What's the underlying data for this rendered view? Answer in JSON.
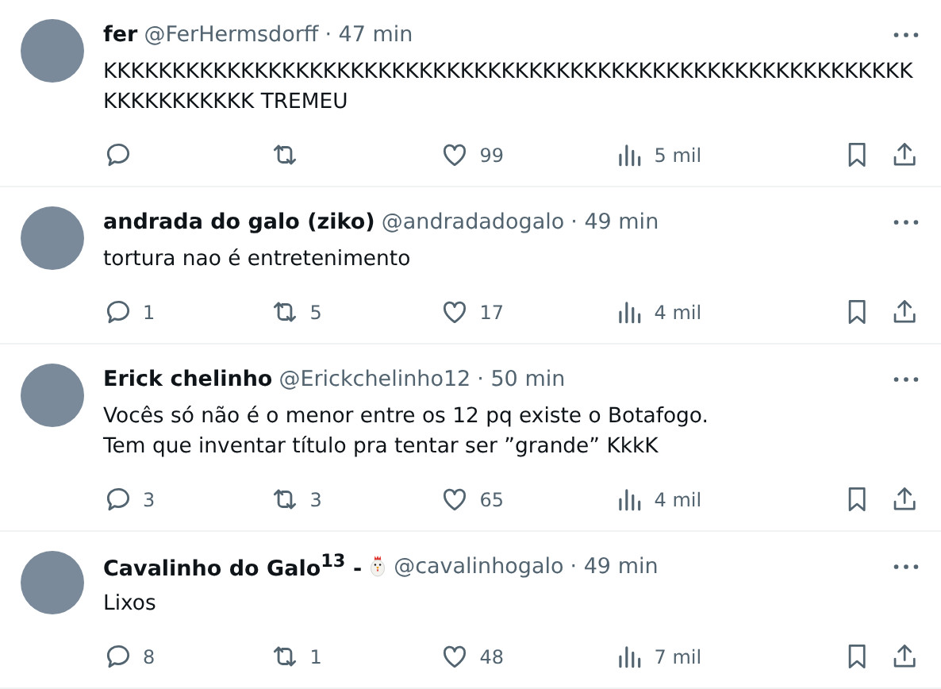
{
  "posts": [
    {
      "name": "fer",
      "handle": "@FerHermsdorff",
      "time": "· 47 min",
      "badge": false,
      "text": [
        "KKKKKKKKKKKKKKKKKKKKKKKKKKKKKKKKKKKKKKKKKKKKKKKKKKKKKKKKKKKKKKKKKKKKKK TREMEU"
      ],
      "likes": "99",
      "views": "5 mil"
    },
    {
      "name": "andrada do galo (ziko)",
      "handle": "@andradadogalo",
      "time": "· 49 min",
      "badge": false,
      "text": [
        "tortura nao é entretenimento"
      ],
      "replies": "1",
      "reposts": "5",
      "likes": "17",
      "views": "4 mil"
    },
    {
      "name": "Erick chelinho",
      "handle": "@Erickchelinho12",
      "time": "· 50 min",
      "badge": false,
      "text": [
        "Vocês só não é o menor entre os 12 pq existe o Botafogo.",
        "Tem que inventar título pra tentar ser ”grande” KkkK"
      ],
      "replies": "3",
      "reposts": "3",
      "likes": "65",
      "views": "4 mil"
    },
    {
      "name": "Cavalinho do Galo$^{13}$ -",
      "handle": "@cavalinhogalo",
      "time": "· 49 min",
      "badge": true,
      "text": [
        "Lixos"
      ],
      "replies": "8",
      "reposts": "1",
      "likes": "48",
      "views": "7 mil"
    }
  ]
}
